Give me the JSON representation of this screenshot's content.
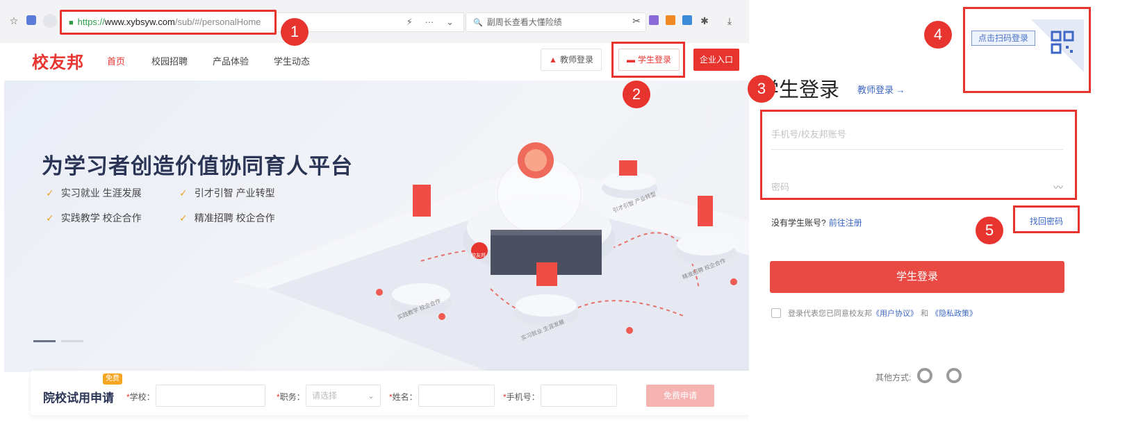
{
  "browser": {
    "url_protocol": "https://",
    "url_host": "www.xybsyw.com",
    "url_path": "/sub/#/personalHome",
    "search_text": "副周长查看大懂险绩",
    "toolbar_glyphs": {
      "star": "☆",
      "bolt": "⚡",
      "more": "···",
      "chevron": "⌄",
      "search": "🔍",
      "cut": "✂",
      "puzzle": "✱",
      "download": "⤓"
    }
  },
  "nav": {
    "logo": "校友邦",
    "links": [
      "首页",
      "校园招聘",
      "产品体验",
      "学生动态"
    ],
    "teacher_login": "教师登录",
    "student_login": "学生登录",
    "enterprise": "企业入口"
  },
  "hero": {
    "title": "为学习者创造价值协同育人平台",
    "features": [
      "实习就业 生涯发展",
      "引才引智 产业转型",
      "实践教学 校企合作",
      "精准招聘 校企合作"
    ],
    "platform_labels": [
      "实践教学 校企合作",
      "引才引智 产业转型",
      "精准招聘 校企合作",
      "实习就业 生涯发展"
    ],
    "center_badge": "校友邦"
  },
  "trial": {
    "title": "院校试用申请",
    "tag": "免费",
    "fields": [
      {
        "label": "学校：",
        "placeholder": ""
      },
      {
        "label": "职务：",
        "placeholder": "请选择"
      },
      {
        "label": "姓名：",
        "placeholder": ""
      },
      {
        "label": "手机号：",
        "placeholder": ""
      }
    ],
    "required_mark": "*",
    "submit": "免费申请"
  },
  "login": {
    "qr_tip": "点击扫码登录",
    "title": "学生登录",
    "teacher_link": "教师登录 →",
    "account_placeholder": "手机号/校友邦账号",
    "password_placeholder": "密码",
    "eye_icon_glyph": "〰",
    "no_account": "没有学生账号?",
    "register": "前往注册",
    "forgot": "找回密码",
    "submit": "学生登录",
    "agree_prefix": "登录代表您已同意校友邦",
    "user_agreement": "《用户协议》",
    "agree_and": "和",
    "privacy_policy": "《隐私政策》",
    "other_methods": "其他方式:"
  },
  "callouts": [
    "1",
    "2",
    "3",
    "4",
    "5"
  ],
  "colors": {
    "brand_red": "#e8342f",
    "link_blue": "#3d67c5",
    "check_orange": "#f0a328",
    "hero_navy": "#2a3556"
  }
}
